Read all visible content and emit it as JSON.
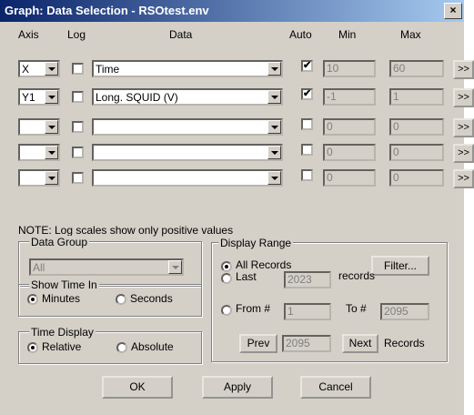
{
  "window": {
    "title": "Graph: Data Selection - RSOtest.env",
    "close_glyph": "×"
  },
  "headers": {
    "axis": "Axis",
    "log": "Log",
    "data": "Data",
    "auto": "Auto",
    "min": "Min",
    "max": "Max"
  },
  "rows": [
    {
      "axis": "X",
      "log": false,
      "data": "Time",
      "auto": true,
      "min": "10",
      "max": "60",
      "more": ">>"
    },
    {
      "axis": "Y1",
      "log": false,
      "data": "Long. SQUID (V)",
      "auto": true,
      "min": "-1",
      "max": "1",
      "more": ">>"
    },
    {
      "axis": "",
      "log": false,
      "data": "",
      "auto": false,
      "min": "0",
      "max": "0",
      "more": ">>"
    },
    {
      "axis": "",
      "log": false,
      "data": "",
      "auto": false,
      "min": "0",
      "max": "0",
      "more": ">>"
    },
    {
      "axis": "",
      "log": false,
      "data": "",
      "auto": false,
      "min": "0",
      "max": "0",
      "more": ">>"
    }
  ],
  "note": "NOTE: Log scales show only positive values",
  "data_group": {
    "label": "Data Group",
    "value": "All"
  },
  "show_time": {
    "label": "Show Time In",
    "minutes": "Minutes",
    "seconds": "Seconds",
    "selected": "minutes"
  },
  "time_display": {
    "label": "Time Display",
    "relative": "Relative",
    "absolute": "Absolute",
    "selected": "relative"
  },
  "display_range": {
    "label": "Display Range",
    "all_records": "All Records",
    "filter": "Filter...",
    "last": "Last",
    "last_value": "2023",
    "records": "records",
    "from": "From #",
    "from_value": "1",
    "to": "To #",
    "to_value": "2095",
    "prev": "Prev",
    "nav_value": "2095",
    "next": "Next",
    "records2": "Records",
    "selected": "all"
  },
  "buttons": {
    "ok": "OK",
    "apply": "Apply",
    "cancel": "Cancel"
  }
}
